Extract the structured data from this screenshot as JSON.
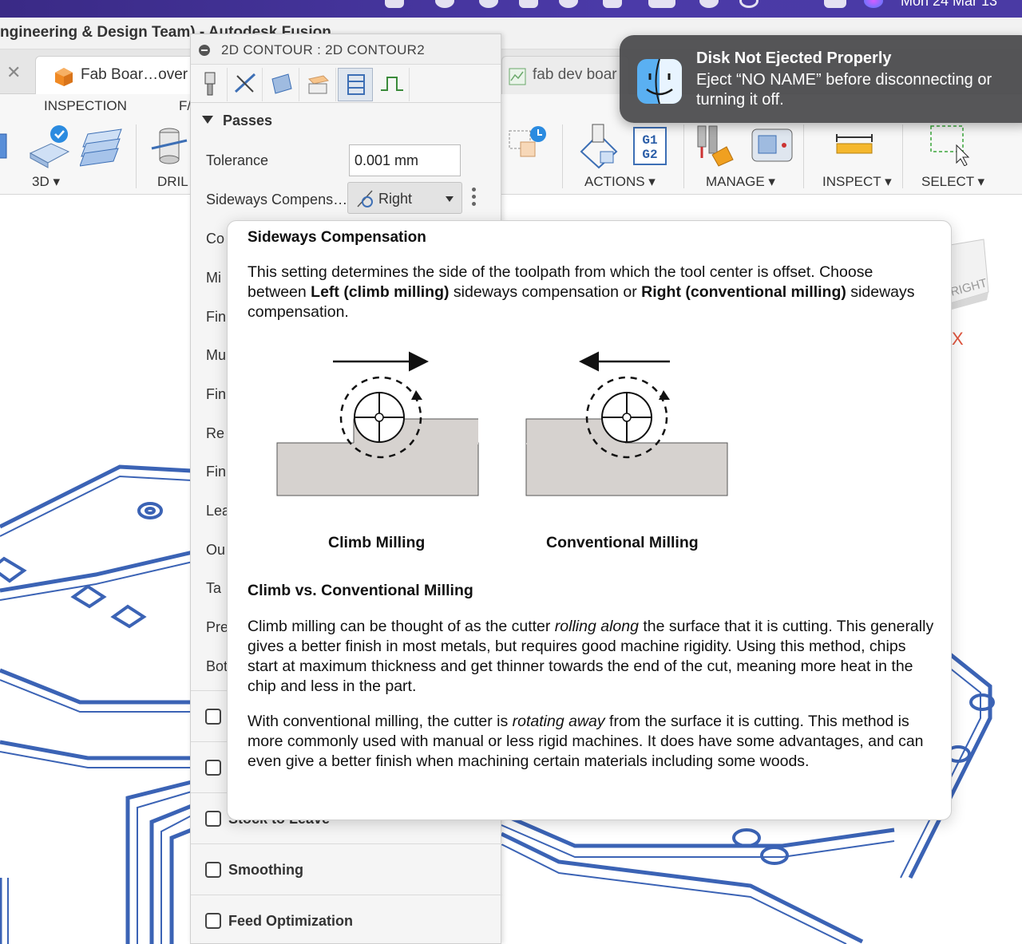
{
  "menubar": {
    "clock": "Mon 24 Mar  13"
  },
  "window": {
    "title": "ngineering & Design Team) - Autodesk Fusion"
  },
  "tabs": [
    {
      "label": "Fab Boar…over"
    },
    {
      "label": "fab dev boar"
    }
  ],
  "toolbar": {
    "groups": {
      "inspection": "INSPECTION",
      "fab_partial": "F/",
      "threed": "3D ▾",
      "drill": "DRIL",
      "actions": "ACTIONS ▾",
      "manage": "MANAGE ▾",
      "inspect": "INSPECT ▾",
      "select": "SELECT ▾"
    },
    "g1g2": "G1\nG2"
  },
  "panel": {
    "title": "2D CONTOUR : 2D CONTOUR2",
    "section": "Passes",
    "tolerance_label": "Tolerance",
    "tolerance_value": "0.001 mm",
    "sideways_label": "Sideways Compens…",
    "sideways_value": "Right",
    "partial_rows": [
      "Co",
      "Mi",
      "Fin",
      "Mu",
      "Fin",
      "Re",
      "Fin",
      "Lea",
      "Ou",
      "Ta",
      "Pre",
      "Bot"
    ],
    "checkbox_rows": [
      "",
      "",
      "Stock to Leave",
      "Smoothing",
      "Feed Optimization"
    ]
  },
  "notification": {
    "title": "Disk Not Ejected Properly",
    "message": "Eject “NO NAME” before disconnecting or turning it off."
  },
  "tooltip": {
    "title": "Sideways Compensation",
    "intro_1": "This setting determines the side of the toolpath from which the tool center is offset. Choose between ",
    "intro_left": "Left (climb milling)",
    "intro_2": " sideways compensation or ",
    "intro_right": "Right (conventional milling)",
    "intro_3": " sideways compensation.",
    "fig_climb": "Climb Milling",
    "fig_conventional": "Conventional Milling",
    "subtitle": "Climb vs. Conventional Milling",
    "p1_a": "Climb milling can be thought of as the cutter ",
    "p1_em": "rolling along",
    "p1_b": " the surface that it is cutting. This generally gives a better finish in most metals, but requires good machine rigidity. Using this method, chips start at maximum thickness and get thinner towards the end of the cut, meaning more heat in the chip and less in the part.",
    "p2_a": "With conventional milling, the cutter is ",
    "p2_em": "rotating away",
    "p2_b": " from the surface it is cutting. This method is more commonly used with manual or less rigid machines. It does have some advantages, and can even give a better finish when machining certain materials including some woods."
  },
  "viewcube": {
    "face": "RIGHT",
    "axis": "X"
  },
  "colors": {
    "trace": "#3b63b5",
    "accent_orange": "#f08a24",
    "notif_bg": "#48484a"
  }
}
